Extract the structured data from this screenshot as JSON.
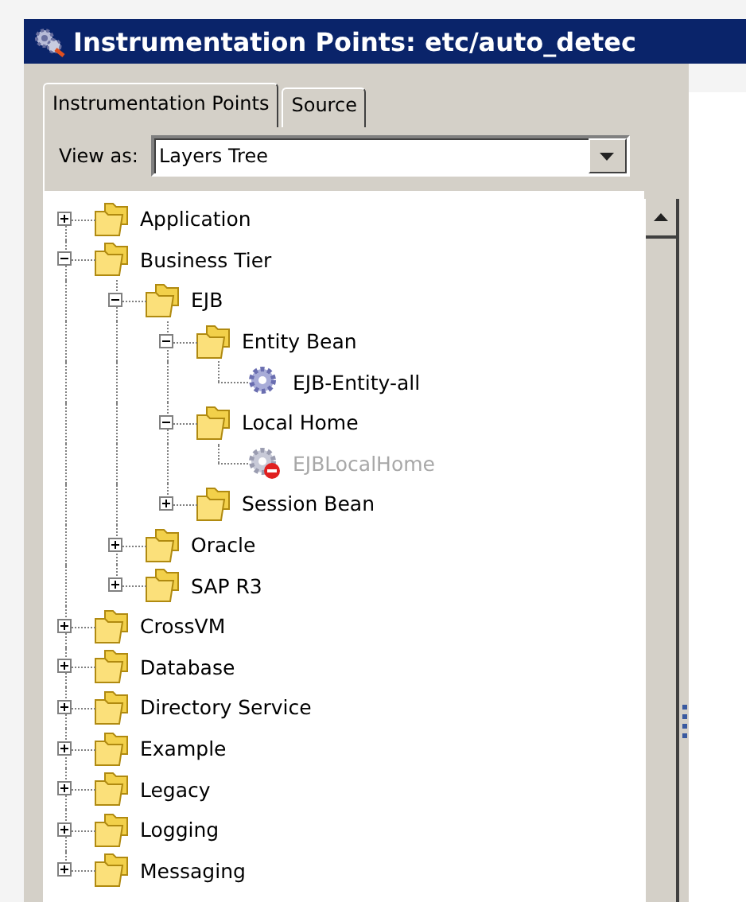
{
  "window": {
    "title": "Instrumentation Points: etc/auto_detec"
  },
  "tabs": [
    {
      "label": "Instrumentation Points",
      "selected": true
    },
    {
      "label": "Source",
      "selected": false
    }
  ],
  "view_as": {
    "label": "View as:",
    "value": "Layers Tree"
  },
  "tree": [
    {
      "label": "Application",
      "kind": "folder",
      "expanded": false
    },
    {
      "label": "Business Tier",
      "kind": "folder",
      "expanded": true,
      "children": [
        {
          "label": "EJB",
          "kind": "folder",
          "expanded": true,
          "children": [
            {
              "label": "Entity Bean",
              "kind": "folder",
              "expanded": true,
              "children": [
                {
                  "label": "EJB-Entity-all",
                  "kind": "point",
                  "disabled": false
                }
              ]
            },
            {
              "label": "Local Home",
              "kind": "folder",
              "expanded": true,
              "children": [
                {
                  "label": "EJBLocalHome",
                  "kind": "point",
                  "disabled": true
                }
              ]
            },
            {
              "label": "Session Bean",
              "kind": "folder",
              "expanded": false
            }
          ]
        },
        {
          "label": "Oracle",
          "kind": "folder",
          "expanded": false
        },
        {
          "label": "SAP R3",
          "kind": "folder",
          "expanded": false
        }
      ]
    },
    {
      "label": "CrossVM",
      "kind": "folder",
      "expanded": false
    },
    {
      "label": "Database",
      "kind": "folder",
      "expanded": false
    },
    {
      "label": "Directory Service",
      "kind": "folder",
      "expanded": false
    },
    {
      "label": "Example",
      "kind": "folder",
      "expanded": false
    },
    {
      "label": "Legacy",
      "kind": "folder",
      "expanded": false
    },
    {
      "label": "Logging",
      "kind": "folder",
      "expanded": false
    },
    {
      "label": "Messaging",
      "kind": "folder",
      "expanded": false
    }
  ]
}
